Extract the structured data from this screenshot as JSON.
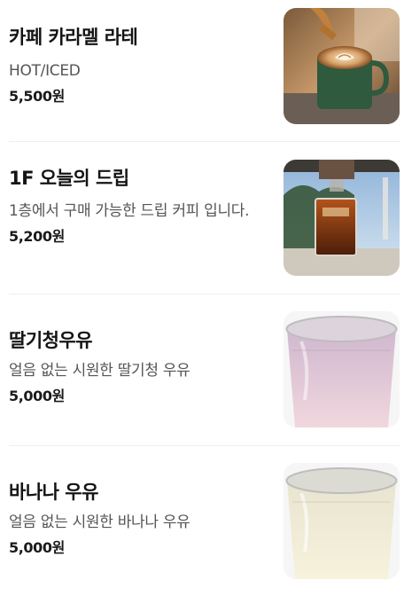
{
  "menu": {
    "items": [
      {
        "name": "카페 카라멜 라테",
        "description": "HOT/ICED",
        "price": "5,500원",
        "image_icon": "latte-photo"
      },
      {
        "name": "1F 오늘의 드립",
        "description": "1층에서 구매 가능한 드립 커피 입니다.",
        "price": "5,200원",
        "image_icon": "drip-coffee-photo"
      },
      {
        "name": "딸기청우유",
        "description": "얼음 없는 시원한 딸기청 우유",
        "price": "5,000원",
        "image_icon": "strawberry-milk-photo"
      },
      {
        "name": "바나나 우유",
        "description": "얼음 없는 시원한 바나나 우유",
        "price": "5,000원",
        "image_icon": "banana-milk-photo"
      }
    ]
  }
}
